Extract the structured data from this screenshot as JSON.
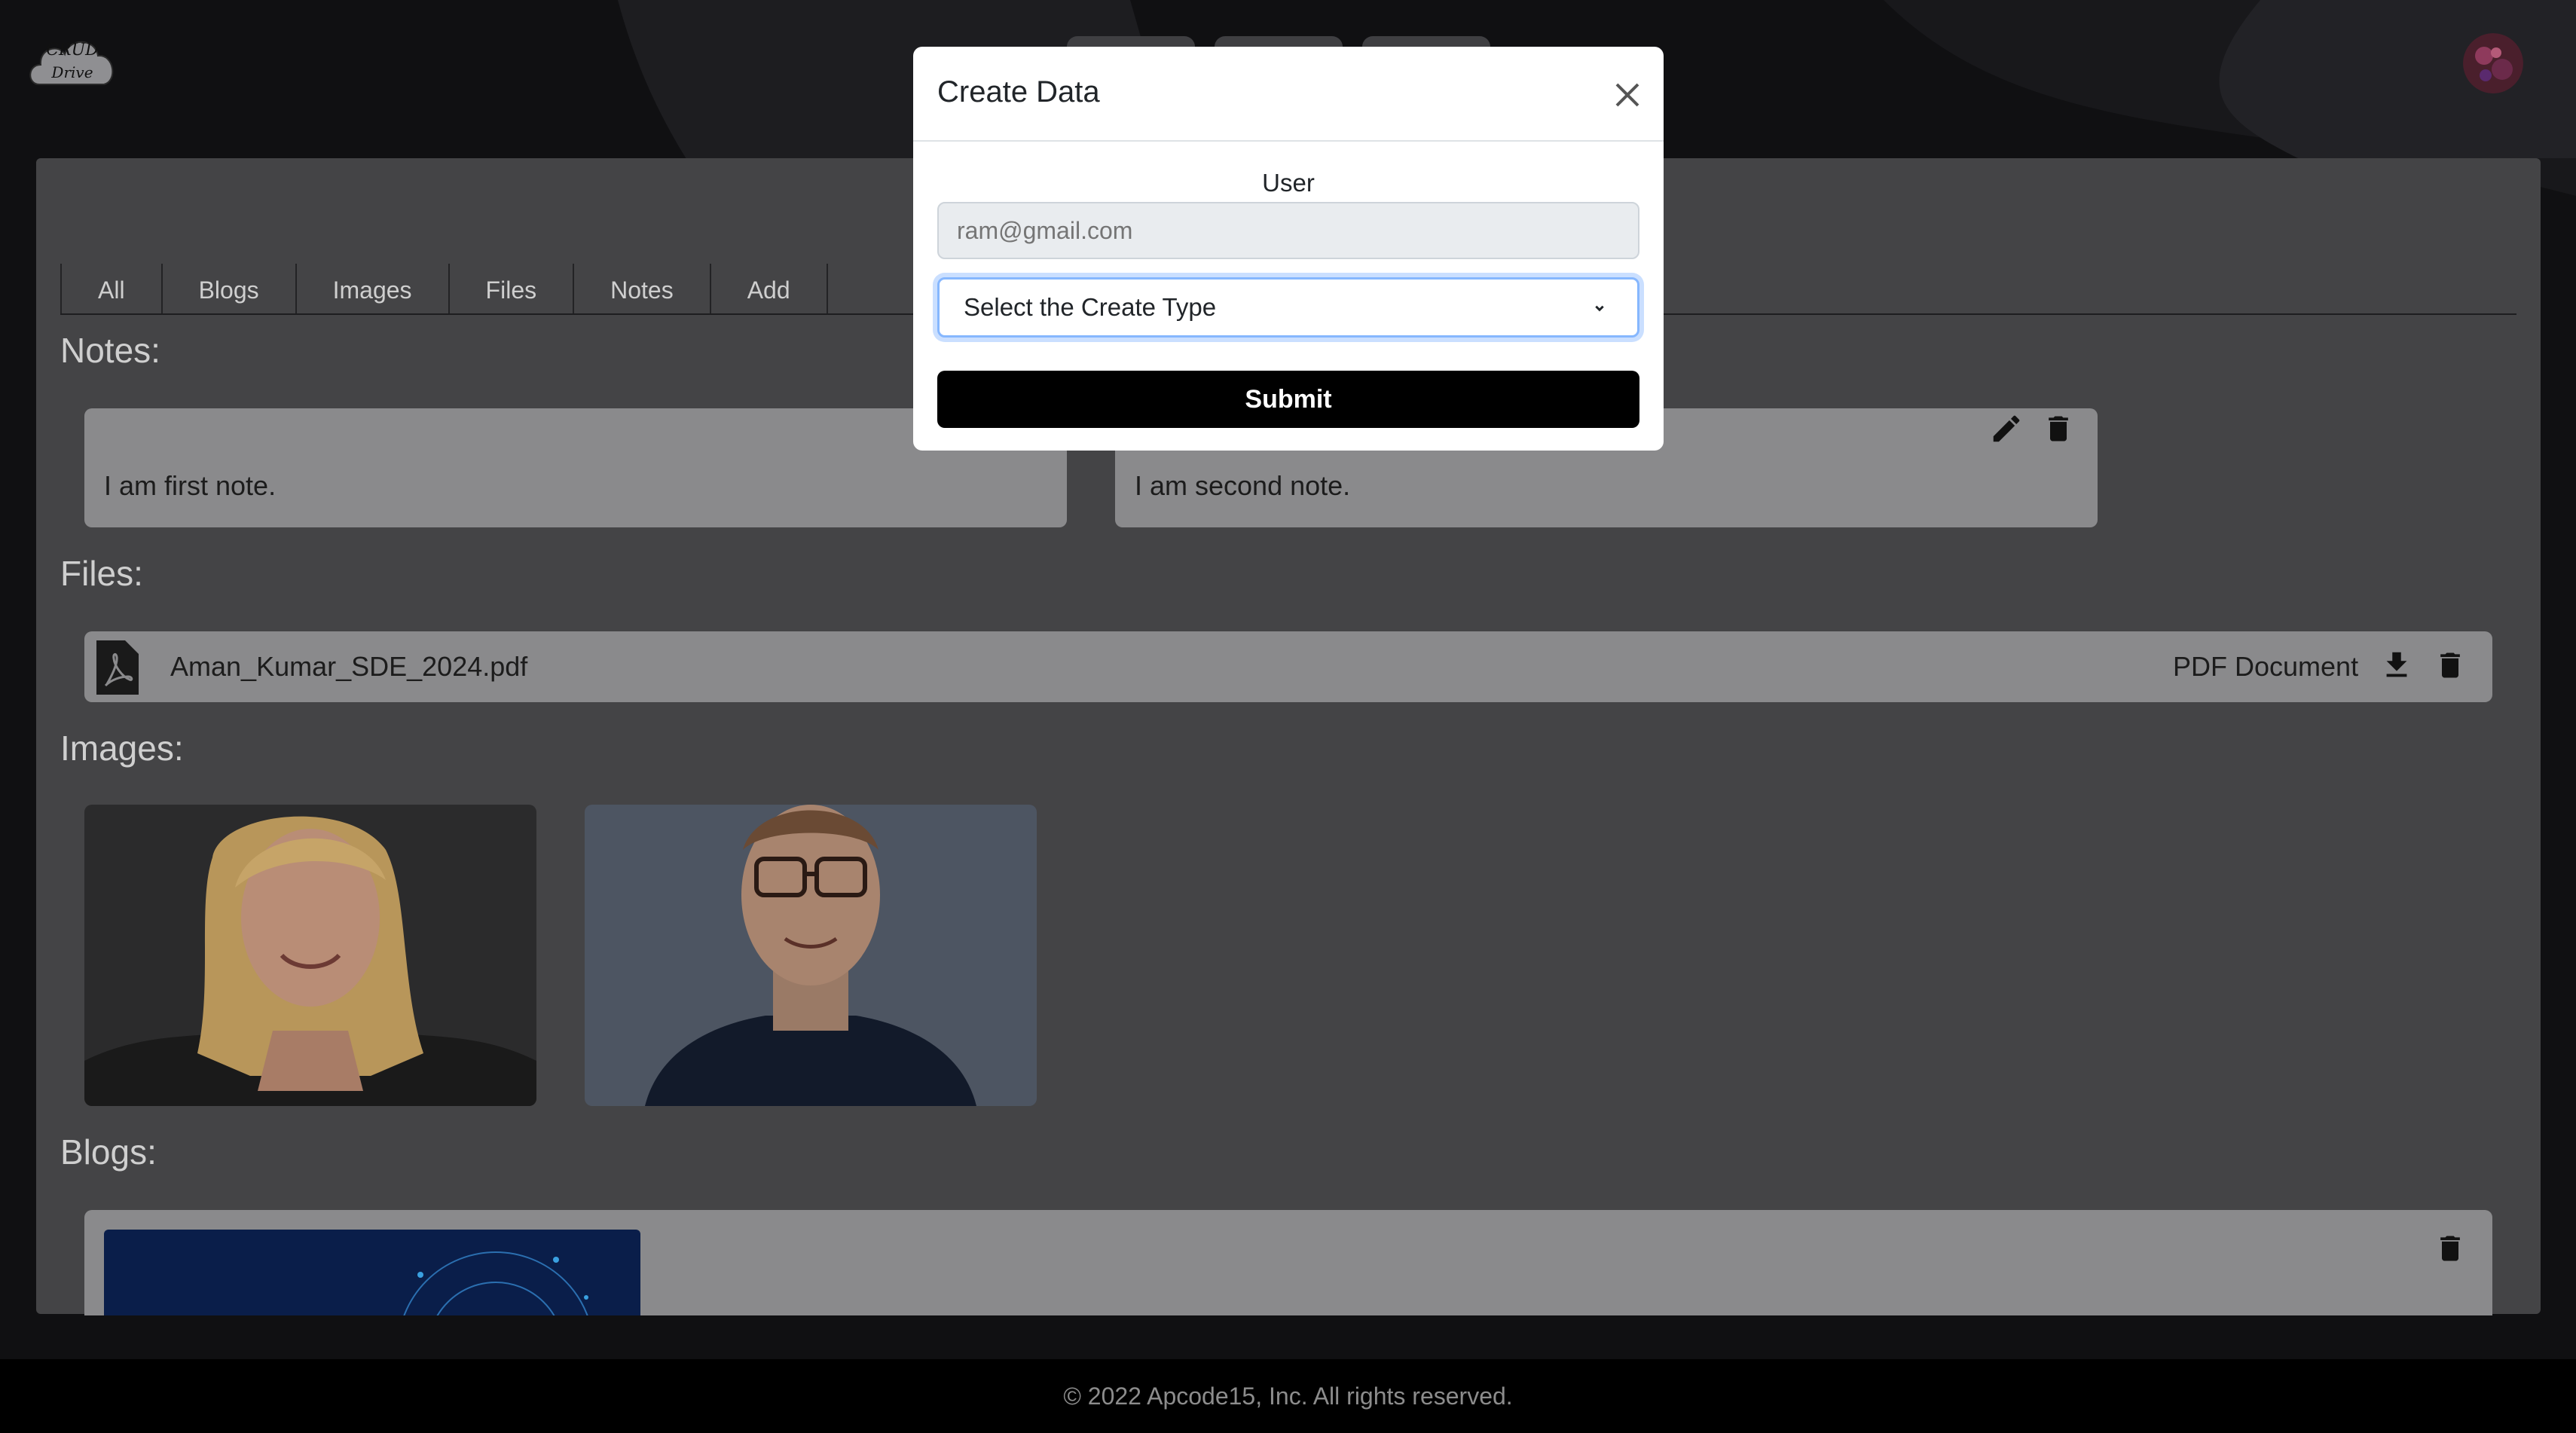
{
  "app": {
    "logo_line1": "CRUD",
    "logo_line2": "Drive"
  },
  "tabs": [
    {
      "label": "All"
    },
    {
      "label": "Blogs"
    },
    {
      "label": "Images"
    },
    {
      "label": "Files"
    },
    {
      "label": "Notes"
    },
    {
      "label": "Add"
    }
  ],
  "sections": {
    "notes_title": "Notes:",
    "files_title": "Files:",
    "images_title": "Images:",
    "blogs_title": "Blogs:"
  },
  "notes": [
    {
      "text": "I am first note."
    },
    {
      "text": "I am second note."
    }
  ],
  "files": [
    {
      "name": "Aman_Kumar_SDE_2024.pdf",
      "type": "PDF Document"
    }
  ],
  "modal": {
    "title": "Create Data",
    "user_label": "User",
    "user_placeholder": "ram@gmail.com",
    "select_value": "Select the Create Type",
    "submit_label": "Submit"
  },
  "footer": {
    "text": "© 2022 Apcode15, Inc. All rights reserved."
  },
  "icons": {
    "close": "close-icon",
    "edit": "pencil-icon",
    "delete": "trash-icon",
    "download": "download-icon",
    "file": "pdf-file-icon",
    "chevron": "chevron-down-icon"
  },
  "colors": {
    "page_bg": "#0c0c0e",
    "panel_bg": "#444446",
    "card_bg": "#8a8a8c",
    "submit_bg": "#000000",
    "focus_border": "#86b7fe"
  }
}
